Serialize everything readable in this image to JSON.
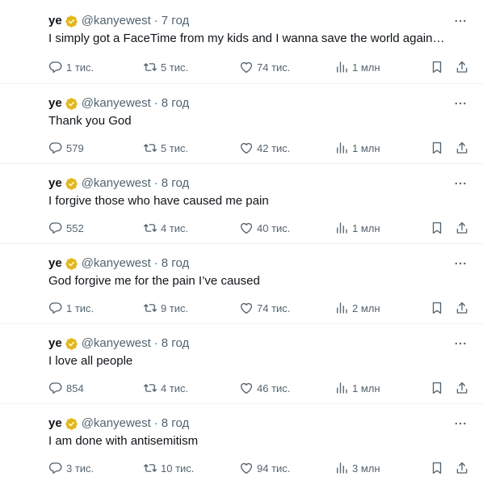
{
  "colors": {
    "text_primary": "#0f1419",
    "text_secondary": "#536471",
    "verified_badge": "#e2b719",
    "divider": "#eff3f4"
  },
  "icons": {
    "reply": "reply-icon",
    "retweet": "retweet-icon",
    "like": "like-icon",
    "views": "views-icon",
    "bookmark": "bookmark-icon",
    "share": "share-icon",
    "more": "more-icon",
    "verified": "verified-badge-icon"
  },
  "tweets": [
    {
      "name": "ye",
      "handle": "@kanyewest",
      "separator": "·",
      "time": "7 год",
      "text": "I simply got a FaceTime from my kids and I wanna save the world again…",
      "replies": "1 тис.",
      "retweets": "5 тис.",
      "likes": "74 тис.",
      "views": "1 млн"
    },
    {
      "name": "ye",
      "handle": "@kanyewest",
      "separator": "·",
      "time": "8 год",
      "text": "Thank you God",
      "replies": "579",
      "retweets": "5 тис.",
      "likes": "42 тис.",
      "views": "1 млн"
    },
    {
      "name": "ye",
      "handle": "@kanyewest",
      "separator": "·",
      "time": "8 год",
      "text": "I forgive those who have caused me pain",
      "replies": "552",
      "retweets": "4 тис.",
      "likes": "40 тис.",
      "views": "1 млн"
    },
    {
      "name": "ye",
      "handle": "@kanyewest",
      "separator": "·",
      "time": "8 год",
      "text": "God forgive me for the pain I’ve caused",
      "replies": "1 тис.",
      "retweets": "9 тис.",
      "likes": "74 тис.",
      "views": "2 млн"
    },
    {
      "name": "ye",
      "handle": "@kanyewest",
      "separator": "·",
      "time": "8 год",
      "text": "I love all people",
      "replies": "854",
      "retweets": "4 тис.",
      "likes": "46 тис.",
      "views": "1 млн"
    },
    {
      "name": "ye",
      "handle": "@kanyewest",
      "separator": "·",
      "time": "8 год",
      "text": "I am done with antisemitism",
      "replies": "3 тис.",
      "retweets": "10 тис.",
      "likes": "94 тис.",
      "views": "3 млн"
    }
  ]
}
